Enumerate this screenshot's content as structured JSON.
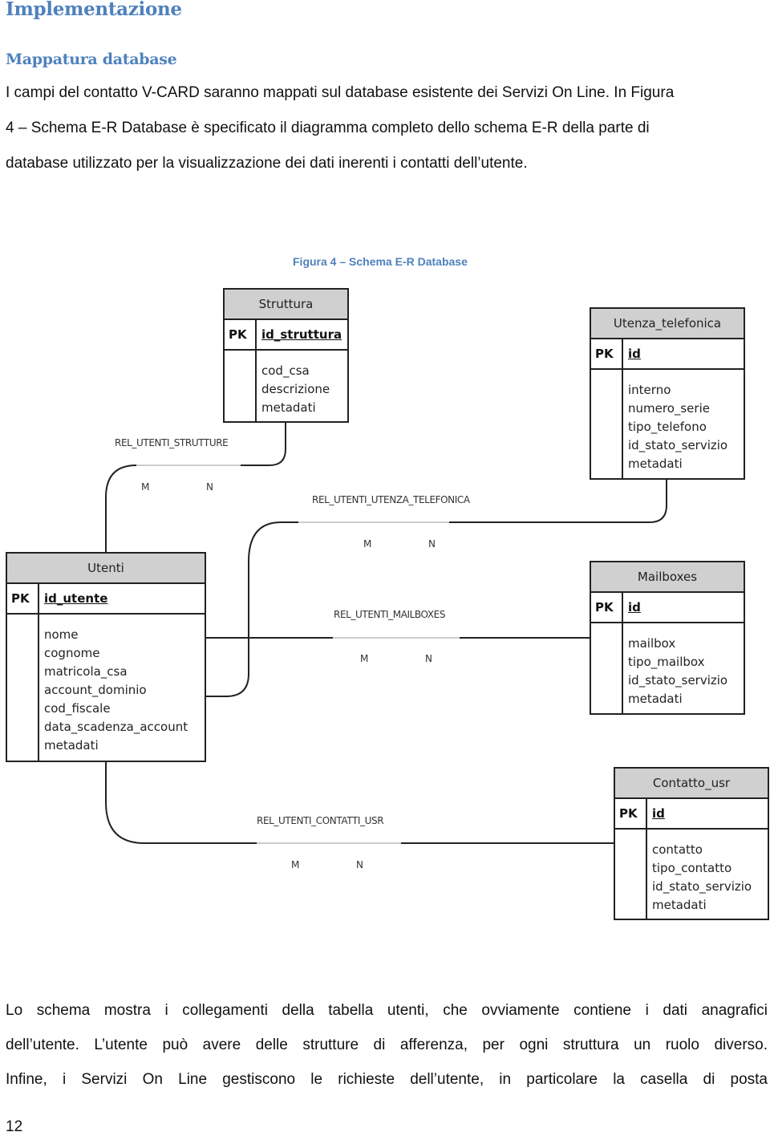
{
  "headings": {
    "h1": "Implementazione",
    "h2": "Mappatura database"
  },
  "intro": {
    "lines": [
      "I campi del contatto V-CARD saranno mappati sul database esistente dei Servizi On Line. In Figura",
      "4 – Schema E-R Database  è specificato il diagramma completo dello schema E-R della parte di",
      "database utilizzato per la visualizzazione dei dati inerenti i contatti dell’utente."
    ]
  },
  "figure": {
    "caption": "Figura 4 – Schema E-R Database",
    "entities": {
      "struttura": {
        "name": "Struttura",
        "pk_label": "PK",
        "pk_field": "id_struttura",
        "fields": [
          "cod_csa",
          "descrizione",
          "metadati"
        ]
      },
      "utenza_telefonica": {
        "name": "Utenza_telefonica",
        "pk_label": "PK",
        "pk_field": "id",
        "fields": [
          "interno",
          "numero_serie",
          "tipo_telefono",
          "id_stato_servizio",
          "metadati"
        ]
      },
      "utenti": {
        "name": "Utenti",
        "pk_label": "PK",
        "pk_field": "id_utente",
        "fields": [
          "nome",
          "cognome",
          "matricola_csa",
          "account_dominio",
          "cod_fiscale",
          "data_scadenza_account",
          "metadati"
        ]
      },
      "mailboxes": {
        "name": "Mailboxes",
        "pk_label": "PK",
        "pk_field": "id",
        "fields": [
          "mailbox",
          "tipo_mailbox",
          "id_stato_servizio",
          "metadati"
        ]
      },
      "contatto_usr": {
        "name": "Contatto_usr",
        "pk_label": "PK",
        "pk_field": "id",
        "fields": [
          "contatto",
          "tipo_contatto",
          "id_stato_servizio",
          "metadati"
        ]
      }
    },
    "relations": {
      "strutture": {
        "name": "REL_UTENTI_STRUTTURE",
        "m": "M",
        "n": "N"
      },
      "telefonica": {
        "name": "REL_UTENTI_UTENZA_TELEFONICA",
        "m": "M",
        "n": "N"
      },
      "mailboxes": {
        "name": "REL_UTENTI_MAILBOXES",
        "m": "M",
        "n": "N"
      },
      "contatti": {
        "name": "REL_UTENTI_CONTATTI_USR",
        "m": "M",
        "n": "N"
      }
    }
  },
  "body": {
    "lines": [
      "Lo schema mostra i collegamenti della tabella utenti, che ovviamente contiene i dati anagrafici",
      "dell’utente. L’utente può avere delle strutture di afferenza, per ogni struttura un ruolo diverso.",
      "Infine, i Servizi On Line gestiscono le richieste dell’utente, in particolare la casella di posta"
    ]
  },
  "page_number": "12"
}
